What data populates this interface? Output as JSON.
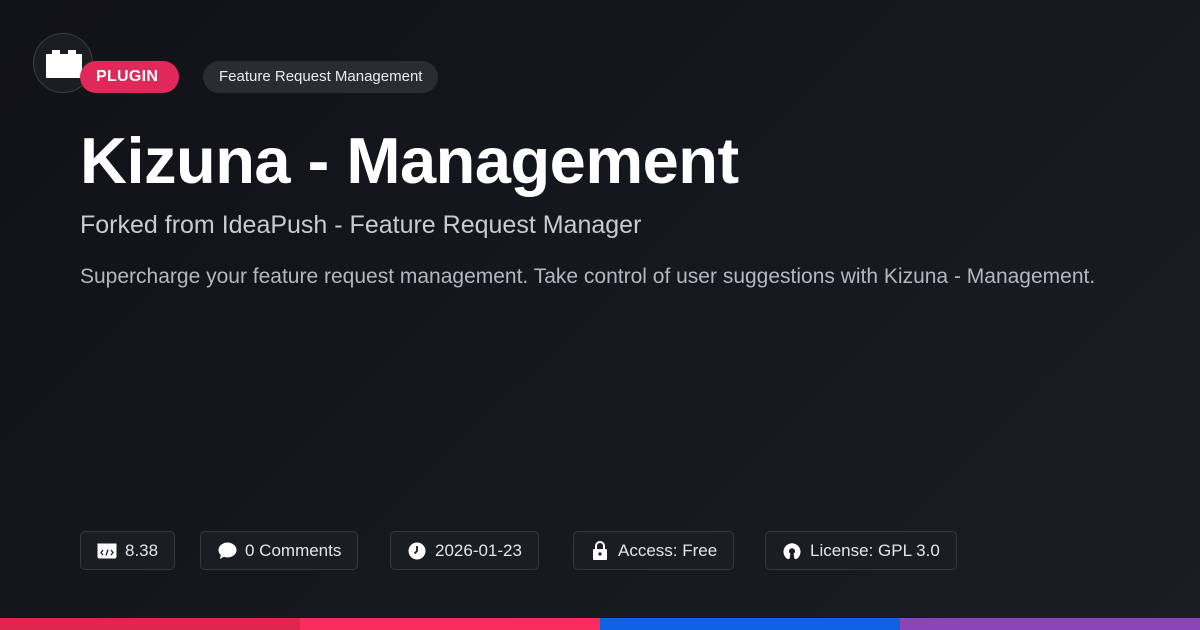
{
  "badge": {
    "label": "PLUGIN",
    "color": "#e1285a"
  },
  "category": "Feature Request Management",
  "title": "Kizuna - Management",
  "subtitle": "Forked from IdeaPush - Feature Request Manager",
  "description": "Supercharge your feature request management. Take control of user suggestions with Kizuna - Management.",
  "meta": [
    {
      "icon": "code-icon",
      "text": "8.38"
    },
    {
      "icon": "comment-icon",
      "text": "0 Comments"
    },
    {
      "icon": "clock-icon",
      "text": "2026-01-23"
    },
    {
      "icon": "lock-icon",
      "text": "Access: Free"
    },
    {
      "icon": "open-source-icon",
      "text": "License: GPL 3.0"
    }
  ],
  "colors": {
    "background": "#14151b",
    "bottom_bar": [
      "#e0264f",
      "#f72d5f",
      "#0d63e4",
      "#8b45b9"
    ]
  }
}
